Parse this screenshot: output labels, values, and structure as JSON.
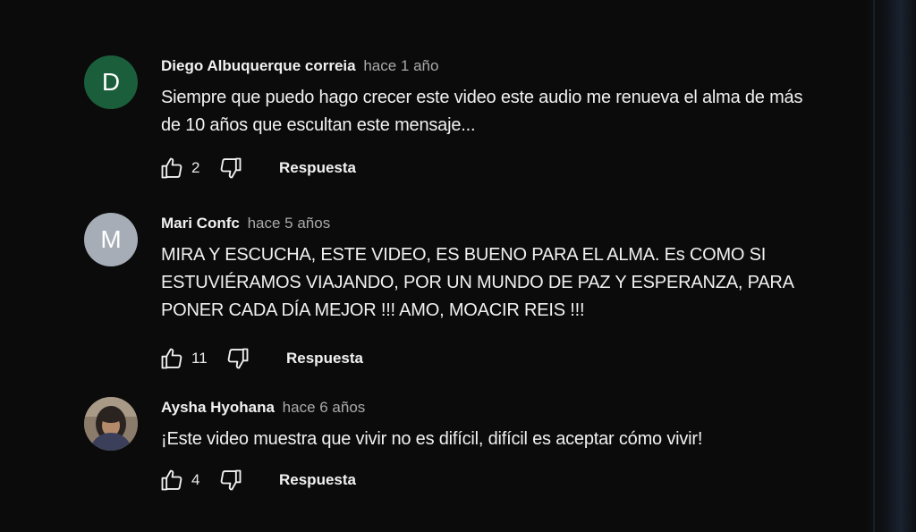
{
  "comments": [
    {
      "avatar_letter": "D",
      "avatar_color": "#1b5e3b",
      "author": "Diego Albuquerque correia",
      "time": "hace 1 año",
      "text": "Siempre que puedo hago crecer este video este audio me renueva el alma de más de 10 años que escultan este mensaje...",
      "likes": "2",
      "reply_label": "Respuesta"
    },
    {
      "avatar_letter": "M",
      "avatar_color": "#a7adb6",
      "author": "Mari Confc",
      "time": "hace 5 años",
      "text": "MIRA Y ESCUCHA, ESTE VIDEO, ES BUENO PARA EL ALMA. Es COMO SI ESTUVIÉRAMOS VIAJANDO, POR UN MUNDO DE PAZ Y ESPERANZA, PARA PONER CADA DÍA MEJOR !!! AMO, MOACIR REIS !!!",
      "likes": "11",
      "reply_label": "Respuesta"
    },
    {
      "avatar_letter": "",
      "avatar_color": "#7a6a5a",
      "author": "Aysha Hyohana",
      "time": "hace 6 años",
      "text": "¡Este video muestra que vivir no es difícil, difícil es aceptar cómo vivir!",
      "likes": "4",
      "reply_label": "Respuesta"
    }
  ]
}
